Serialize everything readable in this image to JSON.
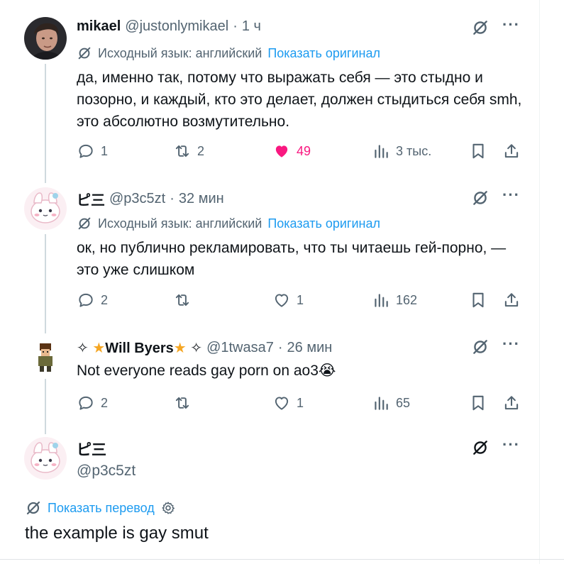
{
  "tweets": [
    {
      "name": "mikael",
      "handle": "@justonlymikael",
      "time": "1 ч",
      "translate_note": "Исходный язык: английский",
      "show_original": "Показать оригинал",
      "text": "да, именно так, потому что выражать себя — это стыдно и позорно, и каждый, кто это делает, должен стыдиться себя smh, это абсолютно возмутительно.",
      "replies": "1",
      "reposts": "2",
      "likes": "49",
      "views": "3 тыс."
    },
    {
      "name": "ピ三",
      "handle": "@p3c5zt",
      "time": "32 мин",
      "translate_note": "Исходный язык: английский",
      "show_original": "Показать оригинал",
      "text": "ок, но публично рекламировать, что ты читаешь гей-порно, — это уже слишком",
      "replies": "2",
      "reposts": "",
      "likes": "1",
      "views": "162"
    },
    {
      "name_prefix": "✧",
      "name_core": "Will Byers",
      "name_suffix": "✧",
      "handle": "@1twasa7",
      "time": "26 мин",
      "text": "Not everyone reads gay porn on ao3",
      "replies": "2",
      "reposts": "",
      "likes": "1",
      "views": "65"
    }
  ],
  "main_tweet": {
    "name": "ピ三",
    "handle": "@p3c5zt",
    "show_translation": "Показать перевод",
    "text": "the example is gay smut"
  },
  "icons": {
    "grok": "grok-slash-icon",
    "more": "more-icon",
    "reply": "reply-icon",
    "repost": "repost-icon",
    "like": "heart-icon",
    "views": "views-icon",
    "bookmark": "bookmark-icon",
    "share": "share-icon",
    "settings": "gear-icon"
  },
  "colors": {
    "text": "#0f1419",
    "muted": "#536471",
    "link": "#1d9bf0",
    "like": "#f91880",
    "thread_line": "#cfd9de"
  }
}
